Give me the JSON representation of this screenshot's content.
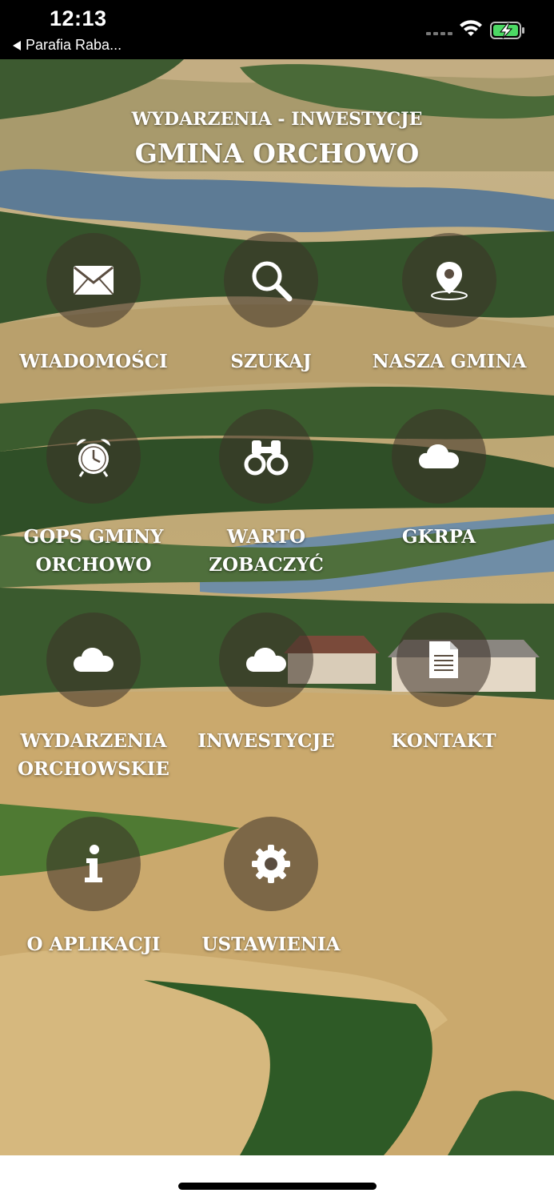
{
  "status_bar": {
    "time": "12:13",
    "back_label": "Parafia Raba...",
    "icons": [
      "cellular-dots-icon",
      "wifi-icon",
      "battery-charging-icon"
    ],
    "battery_color": "#4cd964"
  },
  "header": {
    "subtitle": "WYDARZENIA - INWESTYCJE",
    "title": "GMINA ORCHOWO"
  },
  "menu": [
    {
      "label": "WIADOMOŚCI",
      "icon": "envelope-icon"
    },
    {
      "label": "SZUKAJ",
      "icon": "search-icon"
    },
    {
      "label": "NASZA GMINA",
      "icon": "map-pin-icon"
    },
    {
      "label": "GOPS GMINY ORCHOWO",
      "icon": "alarm-clock-icon"
    },
    {
      "label": "WARTO ZOBACZYĆ",
      "icon": "binoculars-icon"
    },
    {
      "label": "GKRPA",
      "icon": "cloud-icon"
    },
    {
      "label": "WYDARZENIA ORCHOWSKIE",
      "icon": "cloud-icon"
    },
    {
      "label": "INWESTYCJE",
      "icon": "cloud-icon"
    },
    {
      "label": "KONTAKT",
      "icon": "document-icon"
    },
    {
      "label": "O APLIKACJI",
      "icon": "info-icon"
    },
    {
      "label": "USTAWIENIA",
      "icon": "gear-icon"
    }
  ]
}
